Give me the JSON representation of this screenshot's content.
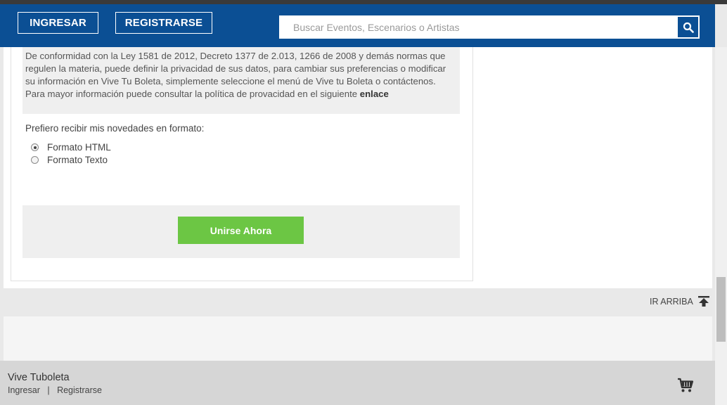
{
  "header": {
    "login_label": "INGRESAR",
    "register_label": "REGISTRARSE",
    "search_placeholder": "Buscar Eventos, Escenarios o Artistas",
    "search_icon": "search-icon"
  },
  "privacy": {
    "text": "De conformidad con la Ley 1581 de 2012, Decreto 1377 de 2.013, 1266 de 2008 y demás normas que regulen la materia, puede definir la privacidad de sus datos, para cambiar sus preferencias o modificar su información en Vive Tu Boleta, simplemente seleccione el menú de Vive tu Boleta o contáctenos. Para mayor información puede consultar la política de provacidad en el siguiente",
    "link_label": "enlace"
  },
  "preferences": {
    "label": "Prefiero recibir mis novedades en formato:",
    "options": [
      {
        "label": "Formato HTML",
        "checked": true
      },
      {
        "label": "Formato Texto",
        "checked": false
      }
    ]
  },
  "join": {
    "button_label": "Unirse Ahora"
  },
  "back_to_top": {
    "label": "IR ARRIBA",
    "icon": "arrow-up-icon"
  },
  "footer": {
    "brand": "Vive Tuboleta",
    "login_link": "Ingresar",
    "separator": "|",
    "register_link": "Registrarse",
    "cart_icon": "cart-icon"
  },
  "colors": {
    "header_bg": "#0b4f94",
    "join_button": "#6cc644",
    "footer_bg": "#d6d6d6"
  }
}
